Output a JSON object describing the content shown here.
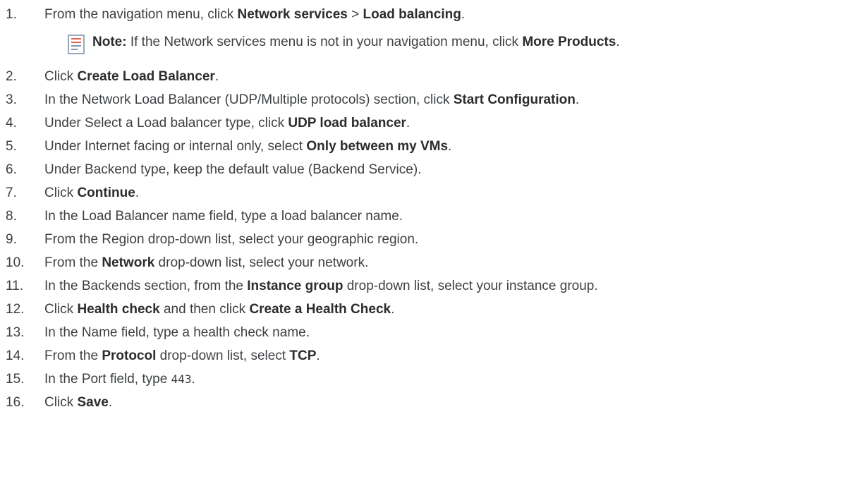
{
  "steps": [
    {
      "num": "1.",
      "parts": [
        {
          "t": "From the navigation menu, click "
        },
        {
          "b": "Network services"
        },
        {
          "t": " > "
        },
        {
          "b": "Load balancing"
        },
        {
          "t": "."
        }
      ]
    },
    {
      "num": "2.",
      "parts": [
        {
          "t": "Click "
        },
        {
          "b": "Create Load Balancer"
        },
        {
          "t": "."
        }
      ]
    },
    {
      "num": "3.",
      "parts": [
        {
          "t": "In the Network Load Balancer (UDP/Multiple protocols) section, click "
        },
        {
          "b": "Start Configuration"
        },
        {
          "t": "."
        }
      ]
    },
    {
      "num": "4.",
      "parts": [
        {
          "t": "Under Select a Load balancer type, click "
        },
        {
          "b": "UDP load balancer"
        },
        {
          "t": "."
        }
      ]
    },
    {
      "num": "5.",
      "parts": [
        {
          "t": "Under Internet facing or internal only, select "
        },
        {
          "b": "Only between my VMs"
        },
        {
          "t": "."
        }
      ]
    },
    {
      "num": "6.",
      "parts": [
        {
          "t": "Under Backend type, keep the default value (Backend Service)."
        }
      ]
    },
    {
      "num": "7.",
      "parts": [
        {
          "t": "Click "
        },
        {
          "b": "Continue"
        },
        {
          "t": "."
        }
      ]
    },
    {
      "num": "8.",
      "parts": [
        {
          "t": "In the Load Balancer name field, type a load balancer name."
        }
      ]
    },
    {
      "num": "9.",
      "parts": [
        {
          "t": "From the Region drop-down list, select your geographic region."
        }
      ]
    },
    {
      "num": "10.",
      "parts": [
        {
          "t": "From the "
        },
        {
          "b": "Network"
        },
        {
          "t": " drop-down list, select your network."
        }
      ]
    },
    {
      "num": "11.",
      "parts": [
        {
          "t": "In the Backends section, from the "
        },
        {
          "b": "Instance group"
        },
        {
          "t": " drop-down list, select your instance group."
        }
      ]
    },
    {
      "num": "12.",
      "parts": [
        {
          "t": "Click "
        },
        {
          "b": "Health check"
        },
        {
          "t": " and then click "
        },
        {
          "b": "Create a Health Check"
        },
        {
          "t": "."
        }
      ]
    },
    {
      "num": "13.",
      "parts": [
        {
          "t": "In the Name field, type a health check name."
        }
      ]
    },
    {
      "num": "14.",
      "parts": [
        {
          "t": "From the "
        },
        {
          "b": "Protocol"
        },
        {
          "t": " drop-down list, select "
        },
        {
          "b": "TCP"
        },
        {
          "t": "."
        }
      ]
    },
    {
      "num": "15.",
      "parts": [
        {
          "t": "In the Port field, type "
        },
        {
          "c": "443"
        },
        {
          "t": "."
        }
      ]
    },
    {
      "num": "16.",
      "parts": [
        {
          "t": "Click "
        },
        {
          "b": "Save"
        },
        {
          "t": "."
        }
      ]
    }
  ],
  "note": {
    "icon": "note-icon",
    "label": "Note:",
    "parts": [
      {
        "t": " If the Network services menu is not in your navigation menu, click "
      },
      {
        "b": "More Products"
      },
      {
        "t": "."
      }
    ]
  },
  "colors": {
    "text": "#3d4043",
    "icon_border": "#7a8ca3",
    "icon_accent": "#e0533a"
  }
}
